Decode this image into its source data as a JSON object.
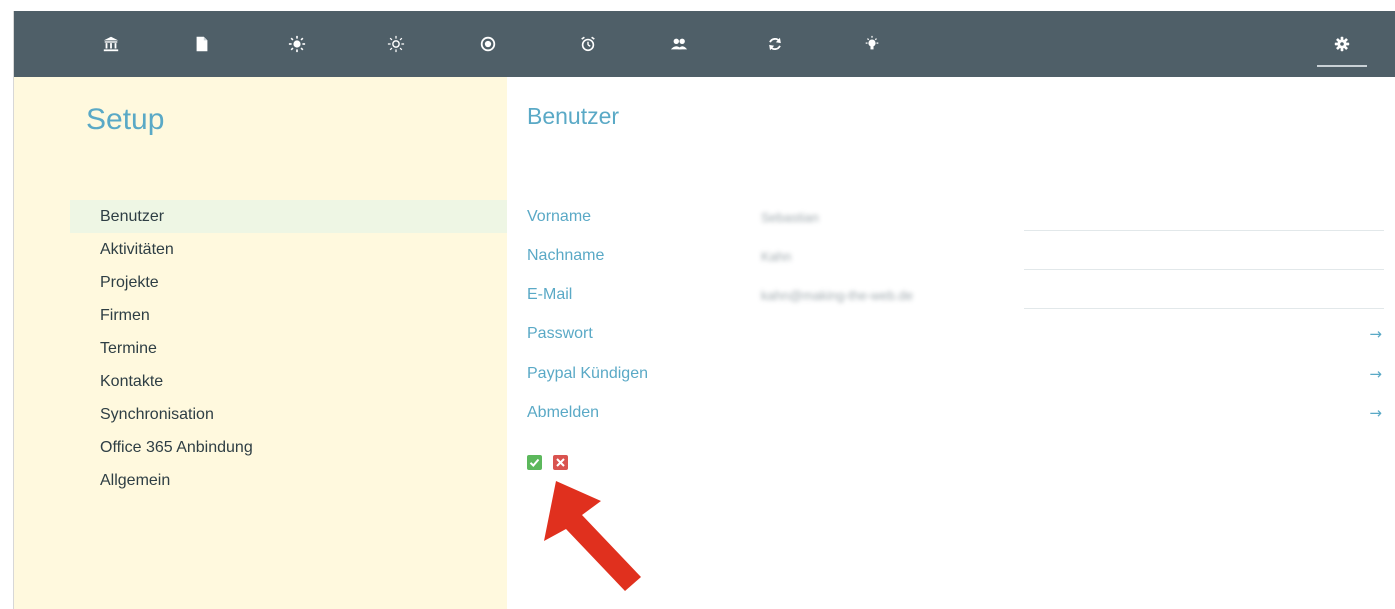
{
  "topbar": {
    "icons": [
      "bank-icon",
      "document-icon",
      "sun-filled-icon",
      "sun-outline-icon",
      "record-icon",
      "alarm-clock-icon",
      "users-icon",
      "sync-icon",
      "lightbulb-icon",
      "gear-icon"
    ]
  },
  "sidebar": {
    "title": "Setup",
    "items": [
      {
        "label": "Benutzer"
      },
      {
        "label": "Aktivitäten"
      },
      {
        "label": "Projekte"
      },
      {
        "label": "Firmen"
      },
      {
        "label": "Termine"
      },
      {
        "label": "Kontakte"
      },
      {
        "label": "Synchronisation"
      },
      {
        "label": "Office 365 Anbindung"
      },
      {
        "label": "Allgemein"
      }
    ]
  },
  "main": {
    "title": "Benutzer",
    "fields": [
      {
        "label": "Vorname",
        "value": "Sebastian"
      },
      {
        "label": "Nachname",
        "value": "Kahn"
      },
      {
        "label": "E-Mail",
        "value": "kahn@making-the-web.de"
      }
    ],
    "links": [
      {
        "label": "Passwort",
        "arrow": "→"
      },
      {
        "label": "Paypal Kündigen",
        "arrow": "→"
      },
      {
        "label": "Abmelden",
        "arrow": "→"
      }
    ]
  },
  "colors": {
    "topbar": "#4f5f68",
    "sidebar": "#fff9de",
    "accent": "#5aa9c6",
    "active_item": "#eef6e4",
    "ok": "#5cb85c",
    "cancel": "#d9534f",
    "annotation_arrow": "#e0301e"
  }
}
